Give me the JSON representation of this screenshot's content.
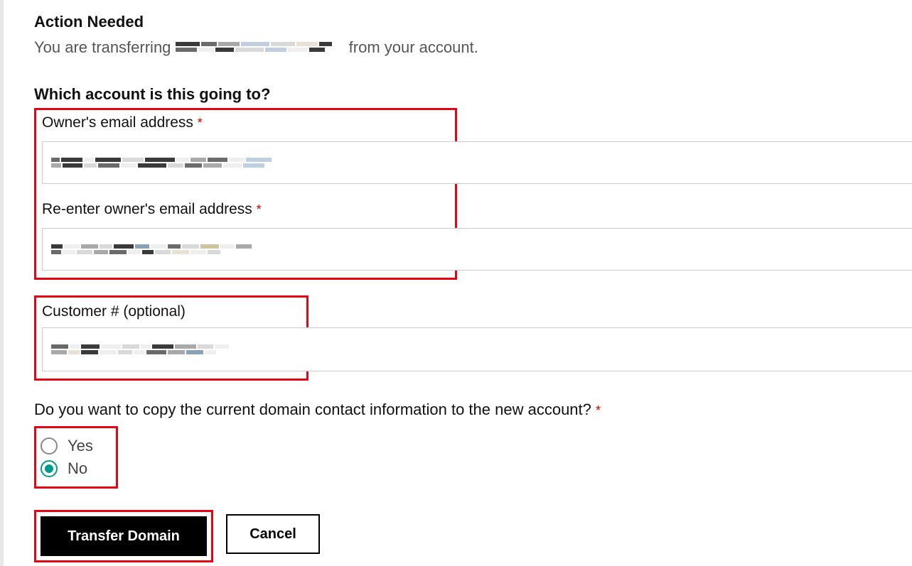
{
  "header": {
    "title": "Action Needed",
    "transfer_prefix": "You are transferring ",
    "transfer_suffix": " from your account."
  },
  "section1": {
    "question": "Which account is this going to?",
    "owner_email_label": "Owner's email address ",
    "reenter_label": "Re-enter owner's email address ",
    "customer_label": "Customer # (optional)"
  },
  "section2": {
    "question": "Do you want to copy the current domain contact information to the new account? ",
    "options": {
      "yes": "Yes",
      "no": "No"
    },
    "selected": "no"
  },
  "buttons": {
    "primary": "Transfer Domain",
    "secondary": "Cancel"
  }
}
